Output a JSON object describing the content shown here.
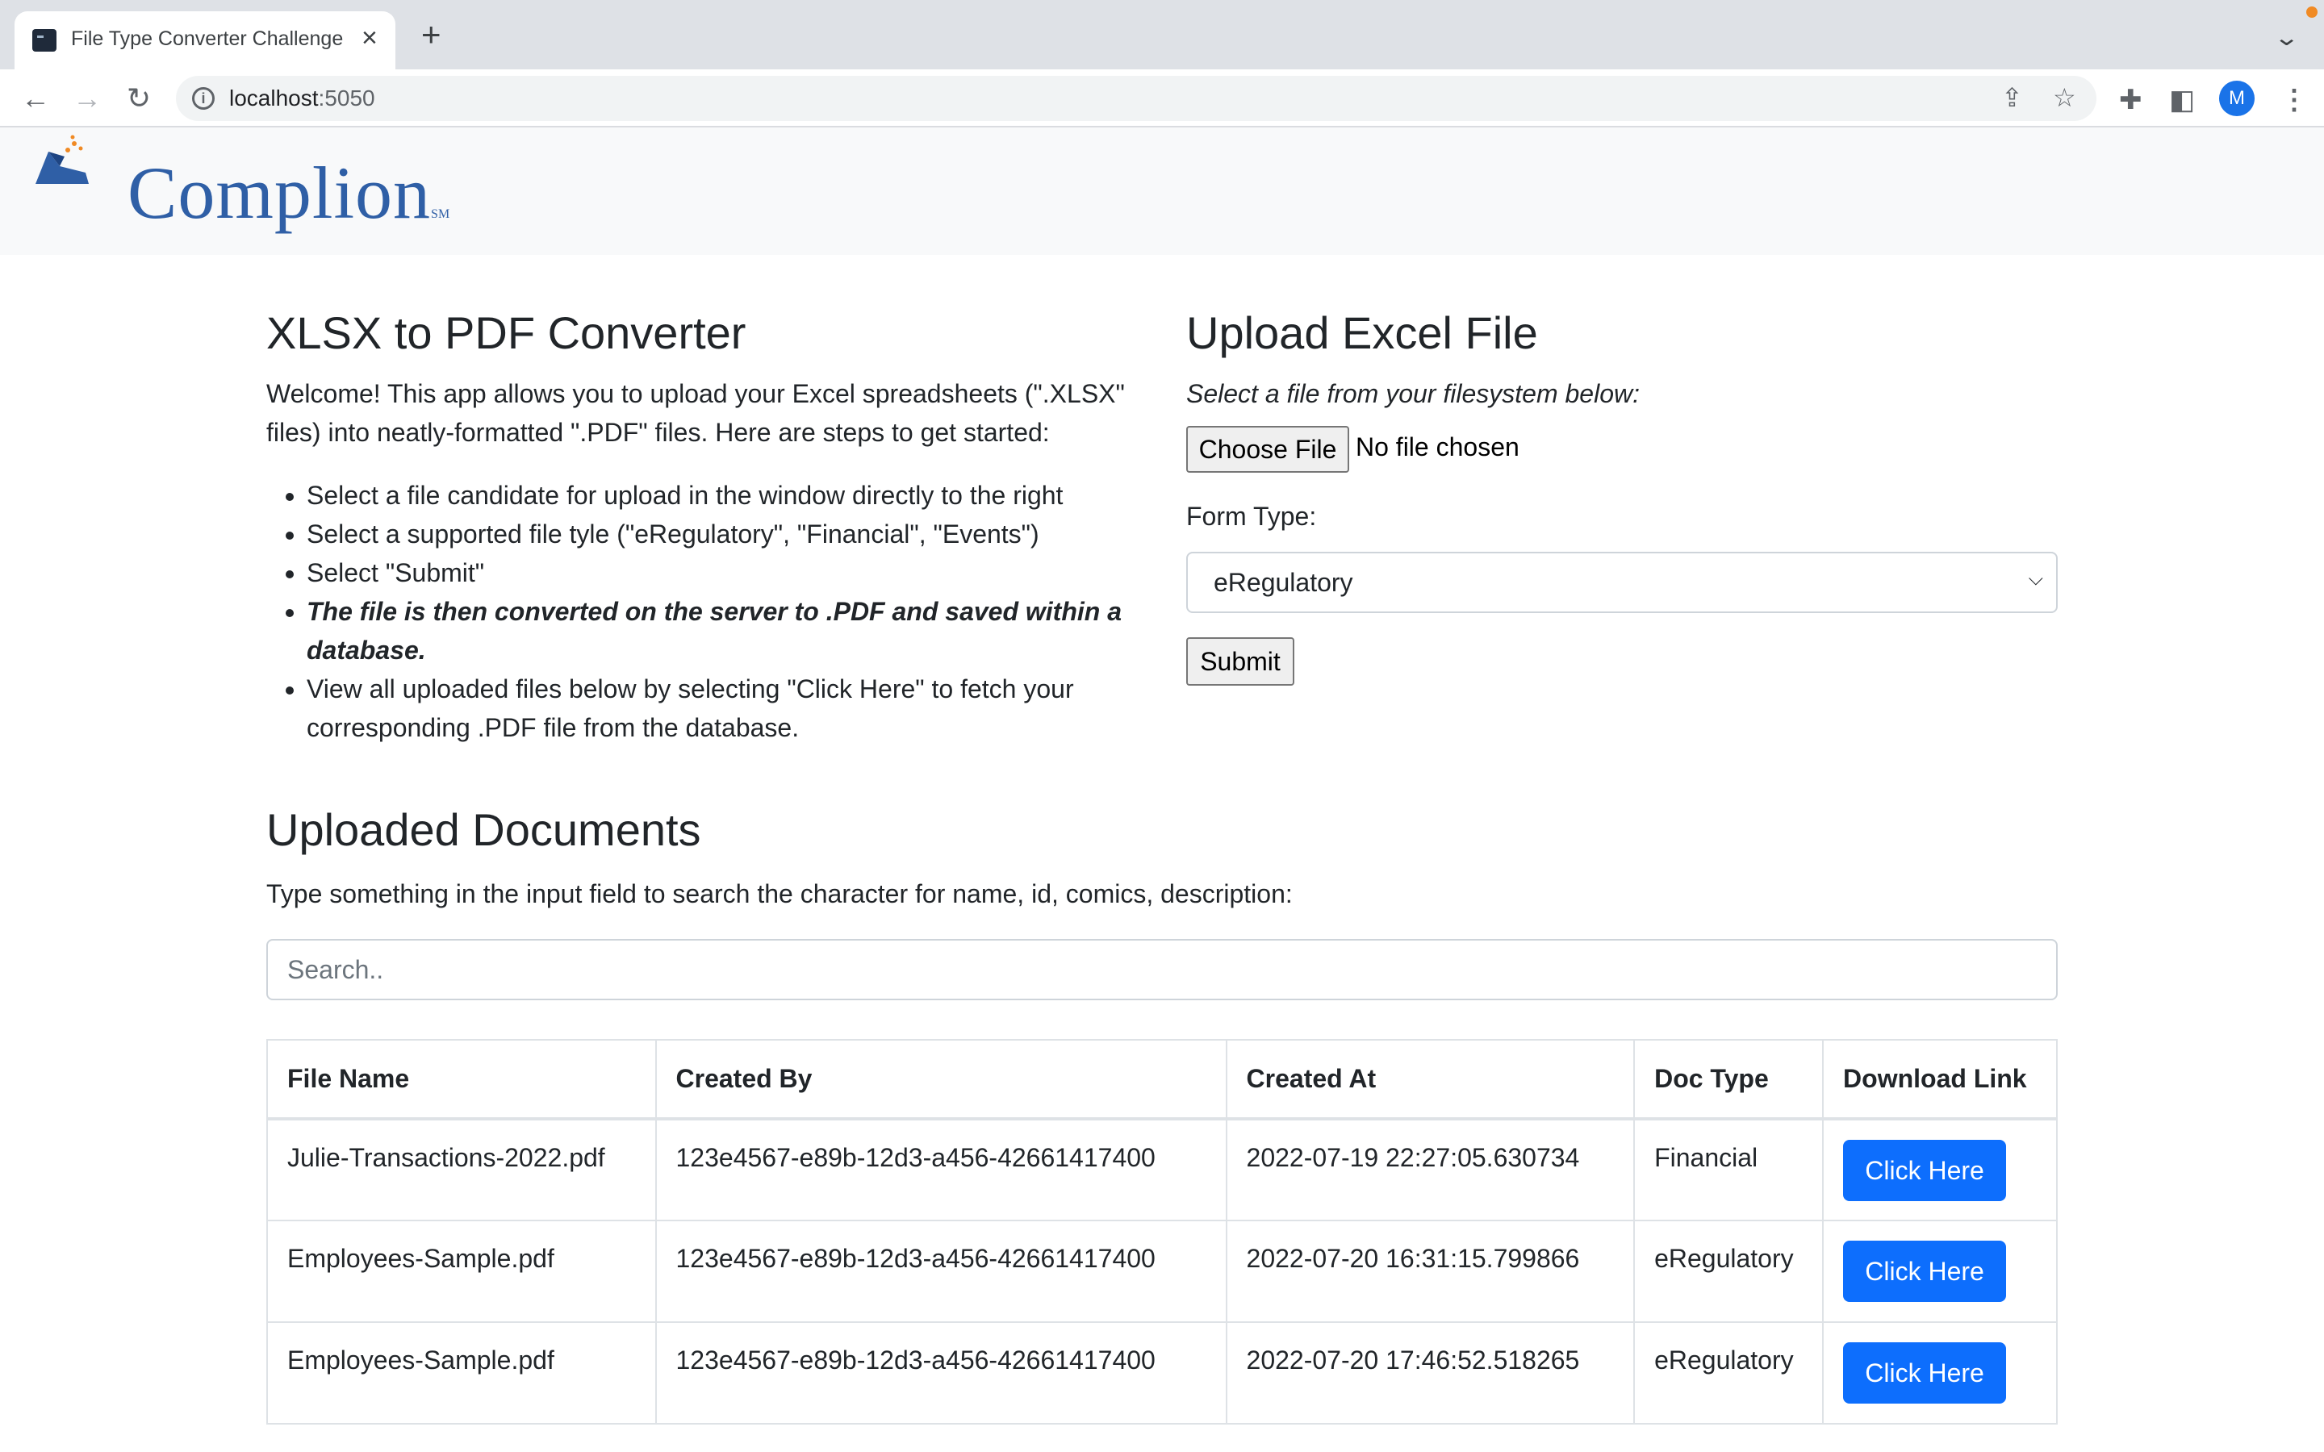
{
  "browser": {
    "tab_title": "File Type Converter Challenge",
    "url_host": "localhost",
    "url_port": ":5050",
    "profile_initial": "M"
  },
  "logo": {
    "text": "Complion",
    "mark": "SM"
  },
  "intro": {
    "title": "XLSX to PDF Converter",
    "description": "Welcome! This app allows you to upload your Excel spreadsheets (\".XLSX\" files) into neatly-formatted \".PDF\" files. Here are steps to get started:",
    "steps": [
      "Select a file candidate for upload in the window directly to the right",
      "Select a supported file tyle (\"eRegulatory\", \"Financial\", \"Events\")",
      "Select \"Submit\"",
      "The file is then converted on the server to .PDF and saved within a database.",
      "View all uploaded files below by selecting \"Click Here\" to fetch your corresponding .PDF file from the database."
    ]
  },
  "upload": {
    "title": "Upload Excel File",
    "hint": "Select a file from your filesystem below:",
    "choose_label": "Choose File",
    "no_file_label": "No file chosen",
    "form_type_label": "Form Type:",
    "form_type_value": "eRegulatory",
    "submit_label": "Submit"
  },
  "documents": {
    "title": "Uploaded Documents",
    "instructions": "Type something in the input field to search the character for name, id, comics, description:",
    "search_placeholder": "Search..",
    "columns": [
      "File Name",
      "Created By",
      "Created At",
      "Doc Type",
      "Download Link"
    ],
    "rows": [
      [
        "Julie-Transactions-2022.pdf",
        "123e4567-e89b-12d3-a456-42661417400",
        "2022-07-19 22:27:05.630734",
        "Financial",
        "Click Here"
      ],
      [
        "Employees-Sample.pdf",
        "123e4567-e89b-12d3-a456-42661417400",
        "2022-07-20 16:31:15.799866",
        "eRegulatory",
        "Click Here"
      ],
      [
        "Employees-Sample.pdf",
        "123e4567-e89b-12d3-a456-42661417400",
        "2022-07-20 17:46:52.518265",
        "eRegulatory",
        "Click Here"
      ]
    ]
  },
  "colors": {
    "primary": "#0d6efd",
    "brand": "#2f5fa6",
    "navbar_bg": "#f8f9fa"
  }
}
